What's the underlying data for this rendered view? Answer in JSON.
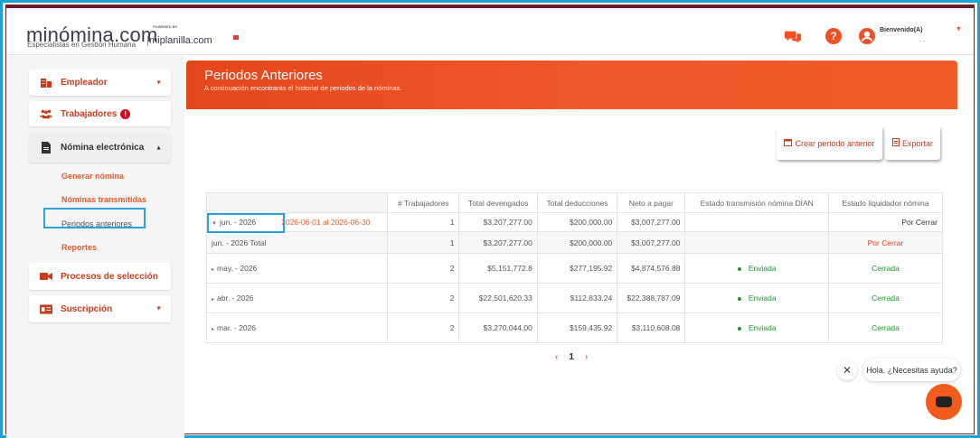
{
  "header": {
    "logo": "minómina.com",
    "logo_tagline": "Especialistas en Gestión Humana",
    "powered_by": "POWERED BY",
    "partner": "miplanilla.com",
    "welcome": "Bienvenido(A)",
    "welcome_dots": ". ."
  },
  "sidebar": {
    "empleador": "Empleador",
    "trabajadores": "Trabajadores",
    "trabajadores_badge": "!",
    "nomina": "Nómina electrónica",
    "sub": [
      "Generar nómina",
      "Nóminas transmitidas",
      "Periodos anteriores",
      "Reportes"
    ],
    "procesos": "Procesos de selección",
    "suscripcion": "Suscripción"
  },
  "banner": {
    "title": "Periodos Anteriores",
    "subtitle": "A continuación encontrarás el historial de periodos de la nóminas."
  },
  "actions": {
    "crear": "Crear periodo anterior",
    "exportar": "Exportar"
  },
  "table": {
    "headers": [
      "",
      "# Trabajadores",
      "Total devengados",
      "Total deducciones",
      "Neto a pagar",
      "Estado transmisión nómina DIAN",
      "Estado liquidador nómina"
    ],
    "rows": [
      {
        "period": "jun. - 2026",
        "range": "2026-06-01 al 2026-06-30",
        "workers": "1",
        "devengados": "$3,207,277.00",
        "deducciones": "$200,000.00",
        "neto": "$3,007,277.00",
        "dian": "",
        "liquidador": "Por Cerrar"
      },
      {
        "period": "jun. - 2026 Total",
        "workers": "1",
        "devengados": "$3,207,277.00",
        "deducciones": "$200,000.00",
        "neto": "$3,007,277.00",
        "dian": "",
        "liquidador": "Por Cerrar"
      },
      {
        "period": "may. - 2026",
        "workers": "2",
        "devengados": "$5,151,772.8",
        "deducciones": "$277,195.92",
        "neto": "$4,874,576.88",
        "dian": "Enviada",
        "liquidador": "Cerrada"
      },
      {
        "period": "abr. - 2026",
        "workers": "2",
        "devengados": "$22,501,620.33",
        "deducciones": "$112,833.24",
        "neto": "$22,388,787.09",
        "dian": "Enviada",
        "liquidador": "Cerrada"
      },
      {
        "period": "mar. - 2026",
        "workers": "2",
        "devengados": "$3,270,044.00",
        "deducciones": "$159,435.92",
        "neto": "$3,110,608.08",
        "dian": "Enviada",
        "liquidador": "Cerrada"
      }
    ]
  },
  "pager": {
    "prev": "‹",
    "page": "1",
    "next": "›"
  },
  "chat": {
    "close": "✕",
    "text": "Hola. ¿Necesitas ayuda?"
  },
  "colors": {
    "accent": "#f15a24",
    "highlight": "#2ba2d4",
    "ok": "#1a9b2a"
  }
}
